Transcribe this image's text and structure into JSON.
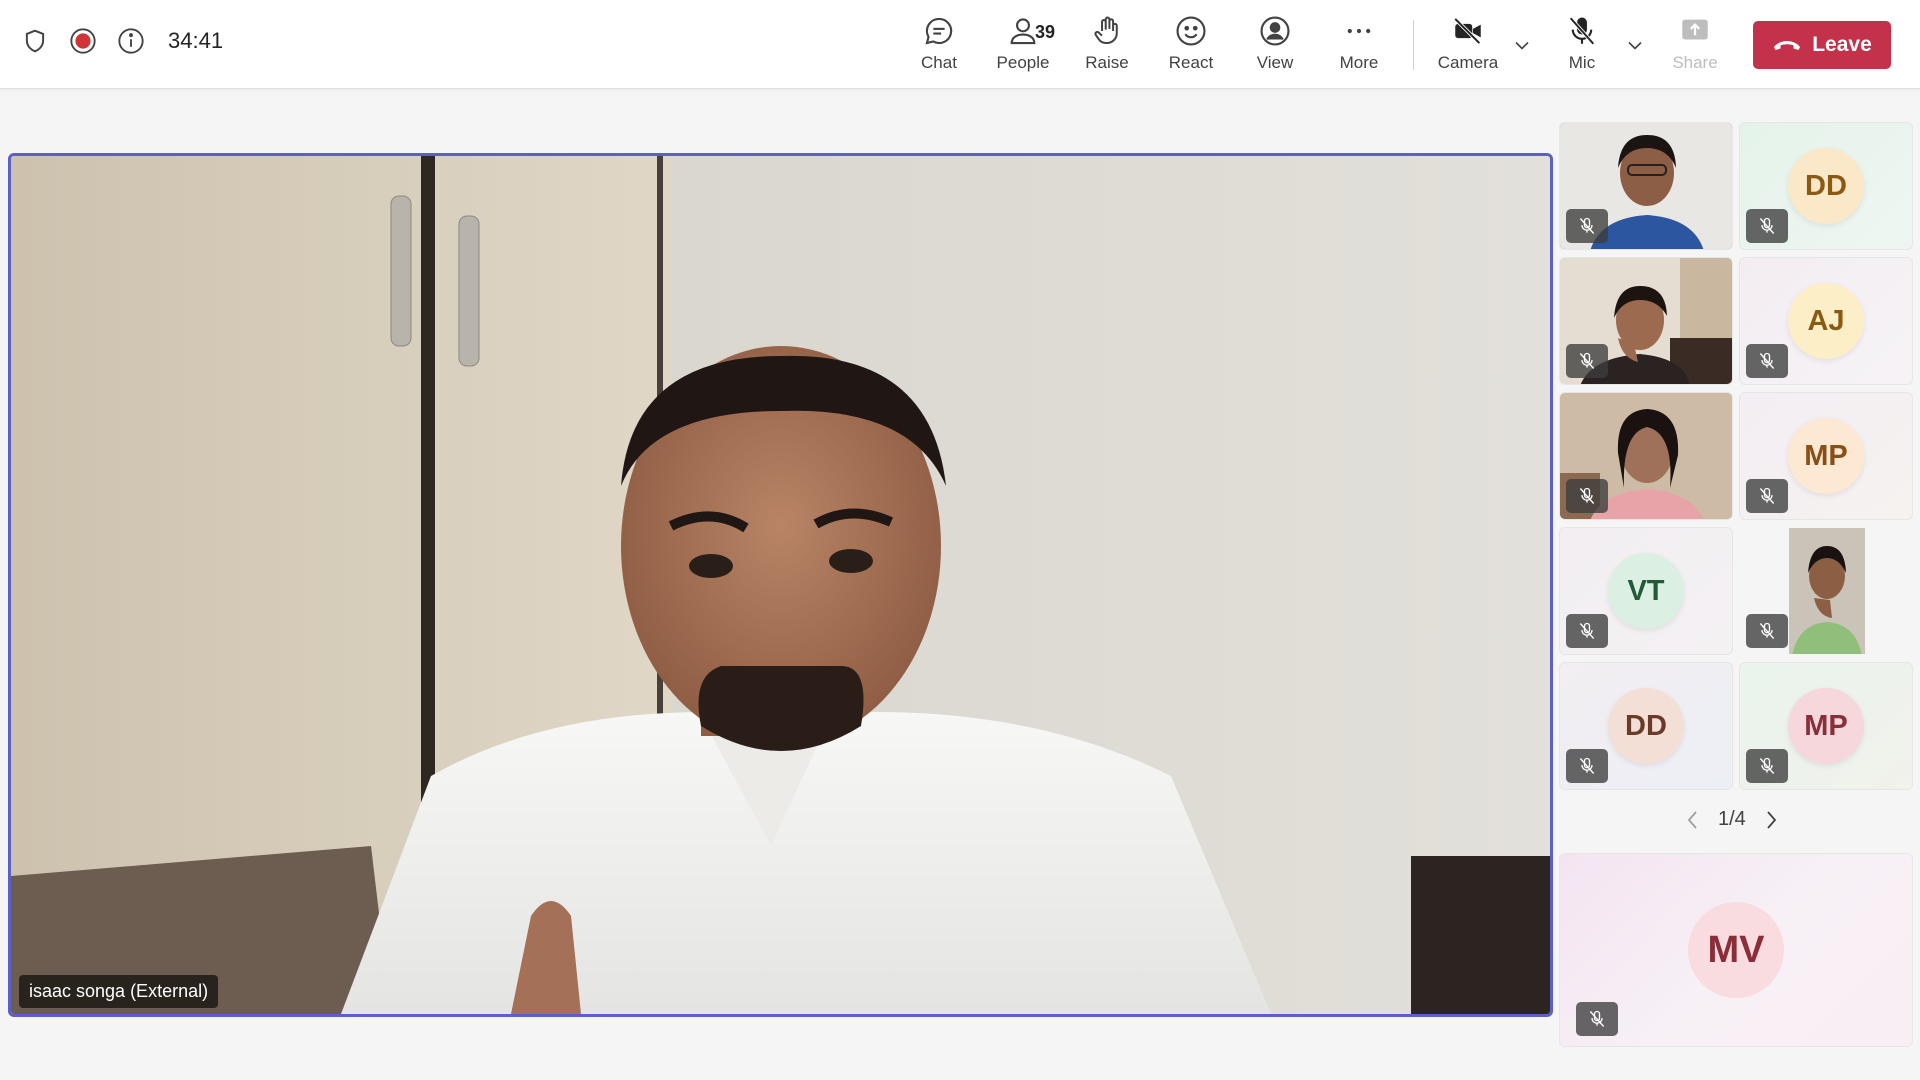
{
  "meeting": {
    "timer": "34:41"
  },
  "toolbar": {
    "chat": "Chat",
    "people": "People",
    "people_count": "39",
    "raise": "Raise",
    "react": "React",
    "view": "View",
    "more": "More",
    "camera": "Camera",
    "mic": "Mic",
    "share": "Share",
    "leave": "Leave"
  },
  "colors": {
    "accent": "#5b5fc7",
    "leave": "#c4314b"
  },
  "main_speaker": {
    "name": "isaac songa (External)"
  },
  "gallery": {
    "tiles": [
      {
        "type": "video"
      },
      {
        "initials": "DD"
      },
      {
        "type": "video"
      },
      {
        "initials": "AJ"
      },
      {
        "type": "video"
      },
      {
        "initials": "MP"
      },
      {
        "initials": "VT"
      },
      {
        "type": "video"
      },
      {
        "initials": "DD"
      },
      {
        "initials": "MP"
      }
    ],
    "page": "1/4"
  },
  "self_tile": {
    "initials": "MV"
  }
}
